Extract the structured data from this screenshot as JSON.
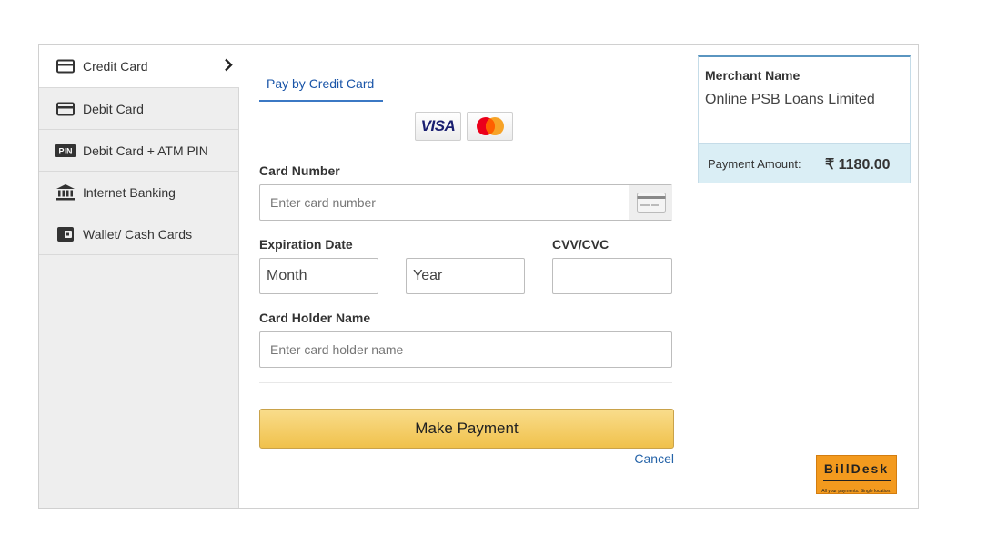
{
  "sidebar": {
    "items": [
      {
        "label": "Credit Card",
        "icon": "credit-card-icon",
        "active": true
      },
      {
        "label": "Debit Card",
        "icon": "debit-card-icon",
        "active": false
      },
      {
        "label": "Debit Card + ATM PIN",
        "icon": "pin-icon",
        "icon_text": "PIN",
        "active": false
      },
      {
        "label": "Internet Banking",
        "icon": "bank-icon",
        "active": false
      },
      {
        "label": "Wallet/ Cash Cards",
        "icon": "wallet-icon",
        "active": false
      }
    ]
  },
  "main": {
    "tab_label": "Pay by Credit Card",
    "brands": {
      "visa_text": "VISA",
      "mastercard": "mastercard-logo"
    },
    "card_number": {
      "label": "Card Number",
      "placeholder": "Enter card number"
    },
    "expiration": {
      "label": "Expiration Date",
      "month": "Month",
      "year": "Year"
    },
    "cvv": {
      "label": "CVV/CVC",
      "placeholder": ""
    },
    "holder": {
      "label": "Card Holder Name",
      "placeholder": "Enter card holder name"
    },
    "pay_button": "Make Payment",
    "cancel": "Cancel"
  },
  "merchant": {
    "title": "Merchant Name",
    "name": "Online PSB Loans Limited",
    "amount_label": "Payment Amount:",
    "amount_value": "₹ 1180.00"
  },
  "logo": {
    "text": "BillDesk",
    "tagline": "All your payments. Single location."
  },
  "colors": {
    "accent_blue": "#3b78c4",
    "button_yellow": "#f0c14b",
    "amount_bg": "#daeef5",
    "logo_orange": "#f39a1e"
  }
}
